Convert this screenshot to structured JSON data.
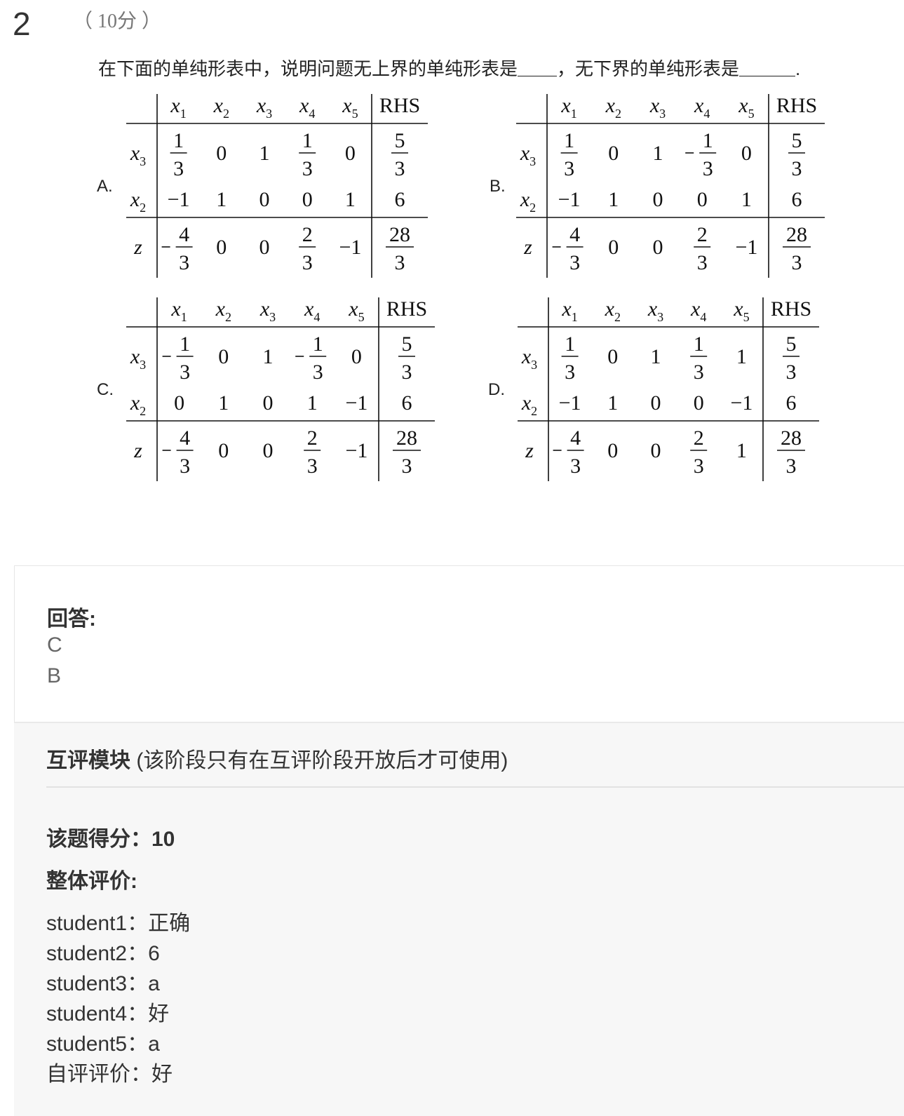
{
  "question": {
    "number": "2",
    "score": "（ 10分 ）",
    "stem_part1": "在下面的单纯形表中，说明问题无上界的单纯形表是",
    "stem_part2": "，无下界的单纯形表是",
    "stem_end": "."
  },
  "tableaux": [
    {
      "label": "A.",
      "header": [
        "x1",
        "x2",
        "x3",
        "x4",
        "x5",
        "RHS"
      ],
      "rows": [
        {
          "basis": "x3",
          "cells": [
            "1/3",
            "0",
            "1",
            "1/3",
            "0",
            "5/3"
          ]
        },
        {
          "basis": "x2",
          "cells": [
            "-1",
            "1",
            "0",
            "0",
            "1",
            "6"
          ]
        },
        {
          "basis": "z",
          "cells": [
            "-4/3",
            "0",
            "0",
            "2/3",
            "-1",
            "28/3"
          ]
        }
      ]
    },
    {
      "label": "B.",
      "header": [
        "x1",
        "x2",
        "x3",
        "x4",
        "x5",
        "RHS"
      ],
      "rows": [
        {
          "basis": "x3",
          "cells": [
            "1/3",
            "0",
            "1",
            "-1/3",
            "0",
            "5/3"
          ]
        },
        {
          "basis": "x2",
          "cells": [
            "-1",
            "1",
            "0",
            "0",
            "1",
            "6"
          ]
        },
        {
          "basis": "z",
          "cells": [
            "-4/3",
            "0",
            "0",
            "2/3",
            "-1",
            "28/3"
          ]
        }
      ]
    },
    {
      "label": "C.",
      "header": [
        "x1",
        "x2",
        "x3",
        "x4",
        "x5",
        "RHS"
      ],
      "rows": [
        {
          "basis": "x3",
          "cells": [
            "-1/3",
            "0",
            "1",
            "-1/3",
            "0",
            "5/3"
          ]
        },
        {
          "basis": "x2",
          "cells": [
            "0",
            "1",
            "0",
            "1",
            "-1",
            "6"
          ]
        },
        {
          "basis": "z",
          "cells": [
            "-4/3",
            "0",
            "0",
            "2/3",
            "-1",
            "28/3"
          ]
        }
      ]
    },
    {
      "label": "D.",
      "header": [
        "x1",
        "x2",
        "x3",
        "x4",
        "x5",
        "RHS"
      ],
      "rows": [
        {
          "basis": "x3",
          "cells": [
            "1/3",
            "0",
            "1",
            "1/3",
            "1",
            "5/3"
          ]
        },
        {
          "basis": "x2",
          "cells": [
            "-1",
            "1",
            "0",
            "0",
            "-1",
            "6"
          ]
        },
        {
          "basis": "z",
          "cells": [
            "-4/3",
            "0",
            "0",
            "2/3",
            "1",
            "28/3"
          ]
        }
      ]
    }
  ],
  "answer": {
    "title": "回答:",
    "lines": [
      "C",
      "B"
    ]
  },
  "review": {
    "title_bold": "互评模块",
    "title_note": " (该阶段只有在互评阶段开放后才可使用)",
    "score_label": "该题得分：",
    "score_value": "10",
    "overall_label": "整体评价:",
    "evaluations": [
      "student1：正确",
      "student2：6",
      "student3：a",
      "student4：好",
      "student5：a",
      "自评评价：好"
    ]
  }
}
